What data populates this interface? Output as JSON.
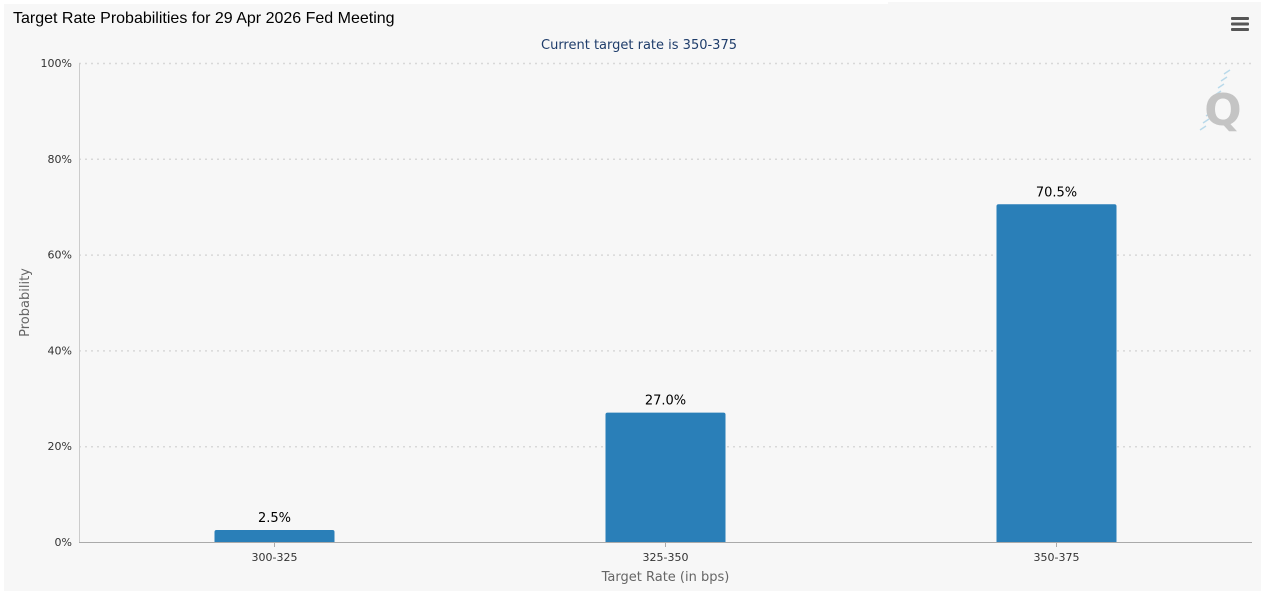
{
  "chart": {
    "title": "Target Rate Probabilities for 29 Apr 2026 Fed Meeting",
    "subtitle": "Current target rate is 350-375",
    "menu_icon": "hamburger-menu-icon",
    "watermark_icon": "q-logo-icon",
    "watermark_text": "Q"
  },
  "colors": {
    "bar": "#2a7fb8",
    "background": "#f7f7f7",
    "grid": "#d8d8d8",
    "axis_text": "#333333",
    "subtitle": "#1f3d6b",
    "axis_title": "#666666"
  },
  "chart_data": {
    "type": "bar",
    "title": "Target Rate Probabilities for 29 Apr 2026 Fed Meeting",
    "subtitle": "Current target rate is 350-375",
    "categories": [
      "300-325",
      "325-350",
      "350-375"
    ],
    "values": [
      2.5,
      27.0,
      70.5
    ],
    "data_labels": [
      "2.5%",
      "27.0%",
      "70.5%"
    ],
    "xlabel": "Target Rate (in bps)",
    "ylabel": "Probability",
    "ylim": [
      0,
      100
    ],
    "yticks": [
      0,
      20,
      40,
      60,
      80,
      100
    ],
    "ytick_labels": [
      "0%",
      "20%",
      "40%",
      "60%",
      "80%",
      "100%"
    ],
    "grid": true,
    "legend": "none"
  }
}
